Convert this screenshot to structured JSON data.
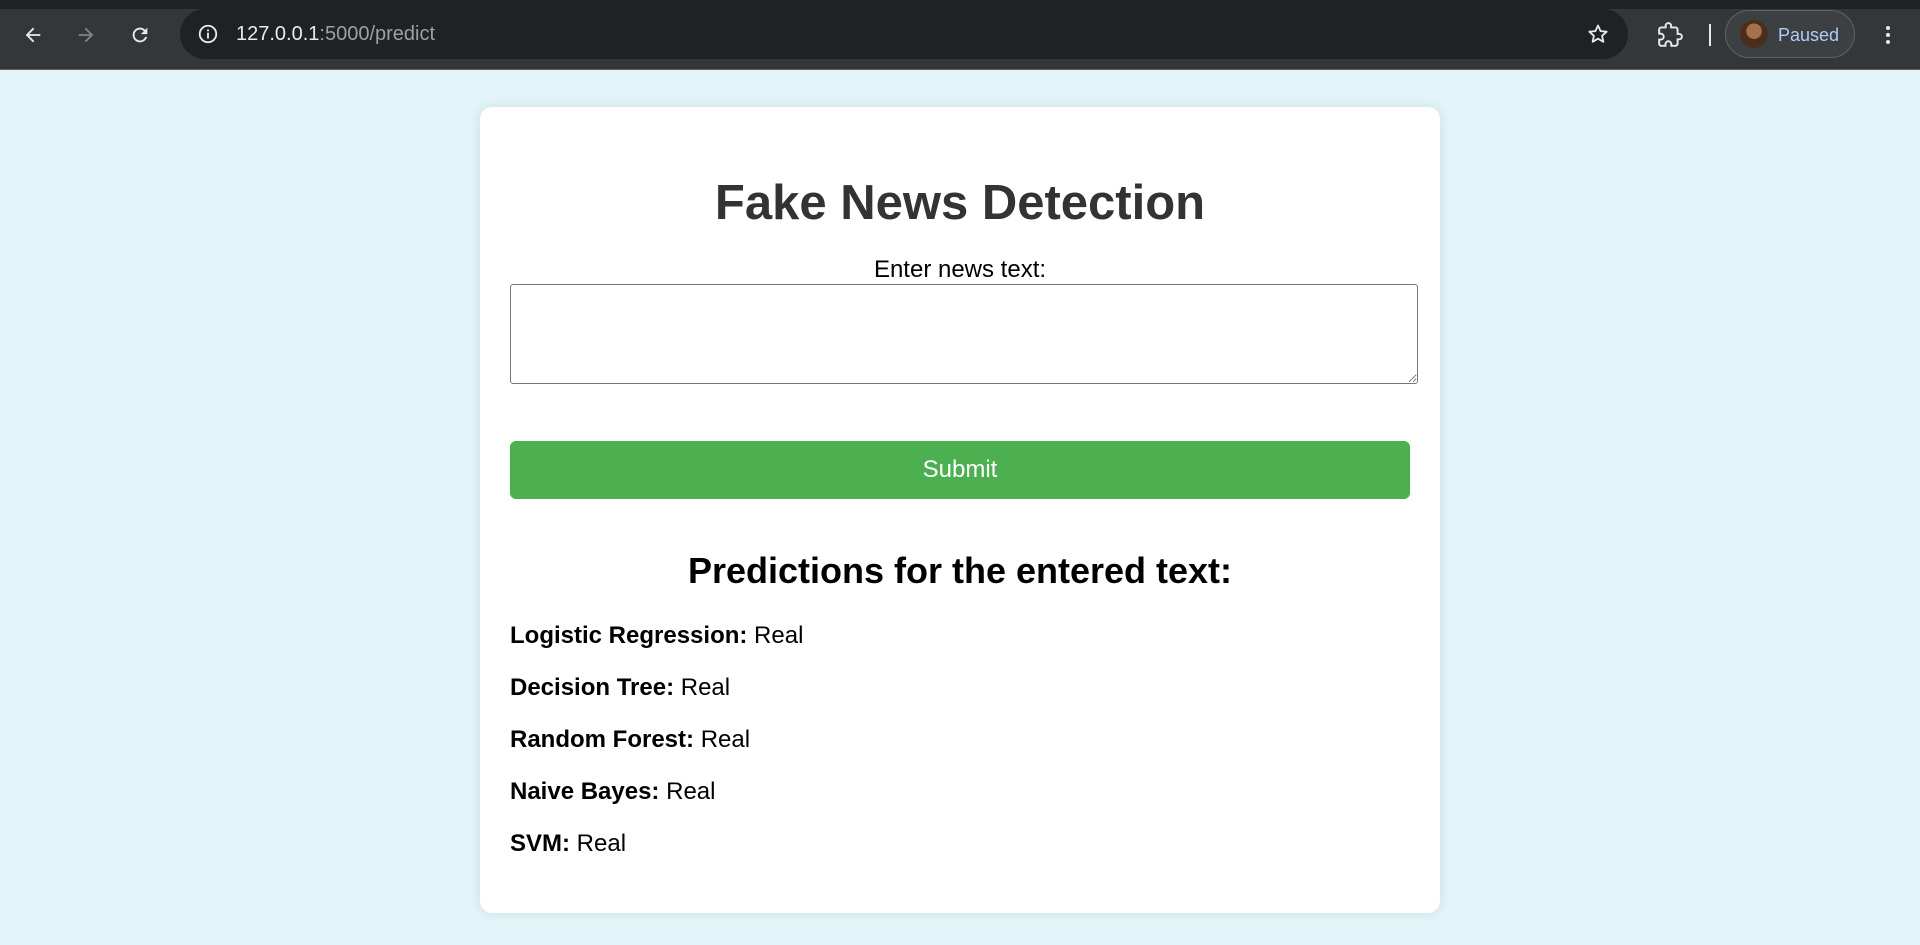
{
  "browser": {
    "url_host": "127.0.0.1",
    "url_rest": ":5000/predict",
    "profile_status": "Paused",
    "icons": [
      "back-arrow-icon",
      "forward-arrow-icon",
      "reload-icon",
      "info-icon",
      "star-icon",
      "extensions-icon",
      "avatar",
      "more-vert-icon"
    ]
  },
  "page": {
    "title": "Fake News Detection",
    "input_label": "Enter news text:",
    "input_value": "",
    "submit_label": "Submit",
    "predictions_title": "Predictions for the entered text:",
    "predictions": [
      {
        "model": "Logistic Regression:",
        "result": "Real"
      },
      {
        "model": "Decision Tree:",
        "result": "Real"
      },
      {
        "model": "Random Forest:",
        "result": "Real"
      },
      {
        "model": "Naive Bayes:",
        "result": "Real"
      },
      {
        "model": "SVM:",
        "result": "Real"
      }
    ]
  },
  "colors": {
    "page_background": "#e3f5f9",
    "card_background": "#ffffff",
    "submit_button": "#4caf50",
    "title_text": "#333333",
    "chrome_background": "#35363a"
  }
}
